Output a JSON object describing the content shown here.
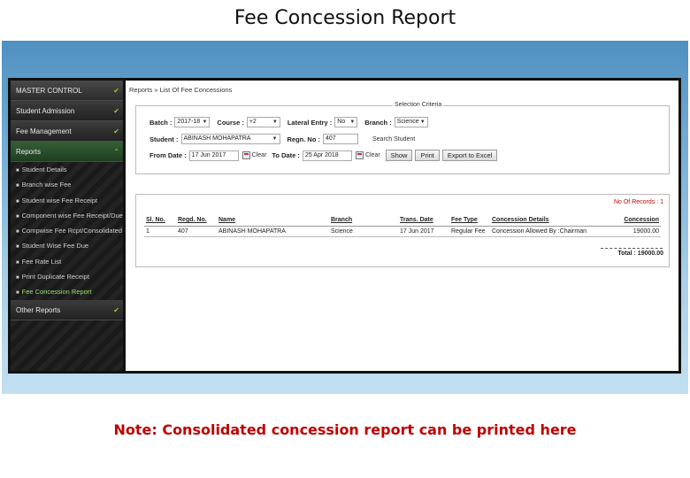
{
  "slide": {
    "title": "Fee Concession Report",
    "note": "Note: Consolidated concession report can be printed here"
  },
  "sidebar": {
    "sections": [
      {
        "label": "MASTER CONTROL",
        "icon": "chevron-down-icon"
      },
      {
        "label": "Student Admission",
        "icon": "chevron-down-icon"
      },
      {
        "label": "Fee Management",
        "icon": "chevron-down-icon"
      },
      {
        "label": "Reports",
        "icon": "chevron-up-icon"
      }
    ],
    "report_items": [
      "Student Details",
      "Branch wise Fee",
      "Student wise Fee Receipt",
      "Component wise Fee Receipt/Due",
      "Compwise Fee Rcpt/Consolidated",
      "Student Wise Fee Due",
      "Fee Rate List",
      "Print Duplicate Receipt",
      "Fee Concession Report"
    ],
    "other": {
      "label": "Other Reports",
      "icon": "chevron-down-icon"
    }
  },
  "breadcrumb": "Reports » List Of Fee Concessions",
  "criteria": {
    "legend": "Selection Criteria",
    "batch_label": "Batch :",
    "batch_value": "2017-18",
    "course_label": "Course :",
    "course_value": "+2",
    "lateral_label": "Lateral Entry :",
    "lateral_value": "No",
    "branch_label": "Branch :",
    "branch_value": "Science",
    "student_label": "Student :",
    "student_value": "ABINASH MOHAPATRA",
    "regn_label": "Regn. No :",
    "regn_value": "407",
    "search_student": "Search Student",
    "from_label": "From Date :",
    "from_value": "17 Jun 2017",
    "clear_label": "Clear",
    "to_label": "To Date :",
    "to_value": "25 Apr 2018",
    "show_button": "Show",
    "print_button": "Print",
    "export_button": "Export to Excel"
  },
  "results": {
    "records_label": "No Of Records : 1",
    "columns": [
      "Sl. No.",
      "Regd. No.",
      "Name",
      "Branch",
      "Trans. Date",
      "Fee Type",
      "Concession Details",
      "Concession"
    ],
    "rows": [
      [
        "1",
        "407",
        "ABINASH MOHAPATRA",
        "Science",
        "17 Jun 2017",
        "Regular Fee",
        "Concession Allowed By :Chairman",
        "19000.00"
      ]
    ],
    "total_label": "Total : 19000.00"
  }
}
